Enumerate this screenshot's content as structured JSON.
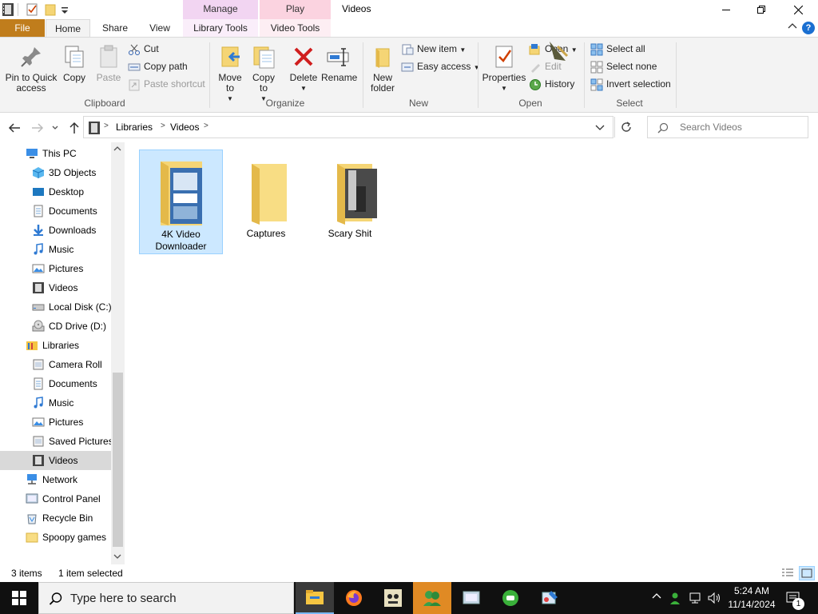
{
  "window": {
    "title": "Videos",
    "context_tabs": [
      {
        "group": "Manage",
        "tab": "Library Tools",
        "color": "#f2d5f2"
      },
      {
        "group": "Play",
        "tab": "Video Tools",
        "color": "#fbd3e0"
      }
    ],
    "minimize_icon": "minimize-icon",
    "maximize_icon": "restore-icon",
    "close_icon": "close-icon"
  },
  "tabs": {
    "file": "File",
    "home": "Home",
    "share": "Share",
    "view": "View"
  },
  "ribbon": {
    "clipboard": {
      "pin": "Pin to Quick access",
      "copy": "Copy",
      "paste": "Paste",
      "cut": "Cut",
      "copy_path": "Copy path",
      "paste_shortcut": "Paste shortcut",
      "label": "Clipboard"
    },
    "organize": {
      "move_to": "Move to",
      "copy_to": "Copy to",
      "delete": "Delete",
      "rename": "Rename",
      "label": "Organize"
    },
    "new": {
      "new_folder": "New folder",
      "new_item": "New item",
      "easy_access": "Easy access",
      "label": "New"
    },
    "open": {
      "properties": "Properties",
      "open": "Open",
      "edit": "Edit",
      "history": "History",
      "label": "Open"
    },
    "select": {
      "select_all": "Select all",
      "select_none": "Select none",
      "invert": "Invert selection",
      "label": "Select"
    }
  },
  "address": {
    "crumbs": [
      "Libraries",
      "Videos"
    ],
    "search_placeholder": "Search Videos"
  },
  "nav": [
    {
      "label": "This PC",
      "icon": "pc-icon",
      "level": 1
    },
    {
      "label": "3D Objects",
      "icon": "3d-objects-icon",
      "level": 2
    },
    {
      "label": "Desktop",
      "icon": "desktop-icon",
      "level": 2
    },
    {
      "label": "Documents",
      "icon": "documents-icon",
      "level": 2
    },
    {
      "label": "Downloads",
      "icon": "downloads-icon",
      "level": 2
    },
    {
      "label": "Music",
      "icon": "music-icon",
      "level": 2
    },
    {
      "label": "Pictures",
      "icon": "pictures-icon",
      "level": 2
    },
    {
      "label": "Videos",
      "icon": "videos-icon",
      "level": 2
    },
    {
      "label": "Local Disk (C:)",
      "icon": "disk-icon",
      "level": 2
    },
    {
      "label": "CD Drive (D:)",
      "icon": "cd-drive-icon",
      "level": 2
    },
    {
      "label": "Libraries",
      "icon": "libraries-icon",
      "level": 1
    },
    {
      "label": "Camera Roll",
      "icon": "library-folder-icon",
      "level": 2
    },
    {
      "label": "Documents",
      "icon": "documents-icon",
      "level": 2
    },
    {
      "label": "Music",
      "icon": "music-icon",
      "level": 2
    },
    {
      "label": "Pictures",
      "icon": "pictures-icon",
      "level": 2
    },
    {
      "label": "Saved Pictures",
      "icon": "library-folder-icon",
      "level": 2
    },
    {
      "label": "Videos",
      "icon": "videos-icon",
      "level": 2,
      "selected": true
    },
    {
      "label": "Network",
      "icon": "network-icon",
      "level": 1
    },
    {
      "label": "Control Panel",
      "icon": "control-panel-icon",
      "level": 1
    },
    {
      "label": "Recycle Bin",
      "icon": "recycle-bin-icon",
      "level": 1
    },
    {
      "label": "Spoopy games",
      "icon": "folder-icon",
      "level": 1
    }
  ],
  "files": [
    {
      "line1": "4K Video",
      "line2": "Downloader",
      "selected": true,
      "icon": "folder-preview-icon"
    },
    {
      "line1": "Captures",
      "line2": "",
      "selected": false,
      "icon": "folder-icon"
    },
    {
      "line1": "Scary Shit",
      "line2": "",
      "selected": false,
      "icon": "folder-preview-icon"
    }
  ],
  "status": {
    "count": "3 items",
    "selection": "1 item selected"
  },
  "taskbar": {
    "search_placeholder": "Type here to search",
    "time": "5:24 AM",
    "date": "11/14/2024",
    "notification_count": "1"
  }
}
